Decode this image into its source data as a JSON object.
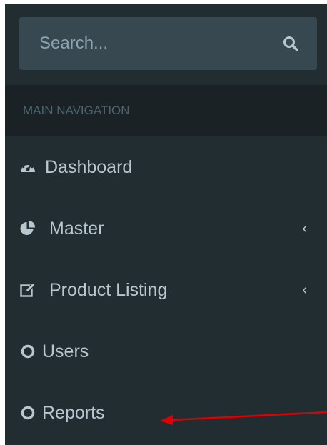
{
  "search": {
    "placeholder": "Search..."
  },
  "nav": {
    "header": "MAIN NAVIGATION",
    "items": [
      {
        "label": "Dashboard",
        "icon": "dashboard-icon",
        "has_children": false
      },
      {
        "label": "Master",
        "icon": "pie-chart-icon",
        "has_children": true
      },
      {
        "label": "Product Listing",
        "icon": "edit-icon",
        "has_children": true
      },
      {
        "label": "Users",
        "icon": "circle-outline-icon",
        "has_children": false
      },
      {
        "label": "Reports",
        "icon": "circle-outline-icon",
        "has_children": false
      }
    ],
    "chevron_glyph": "‹"
  },
  "colors": {
    "sidebar_bg": "#222d32",
    "header_bg": "#1a2226",
    "search_bg": "#374850",
    "text": "#b8c7ce",
    "annotation_arrow": "#e00000"
  }
}
